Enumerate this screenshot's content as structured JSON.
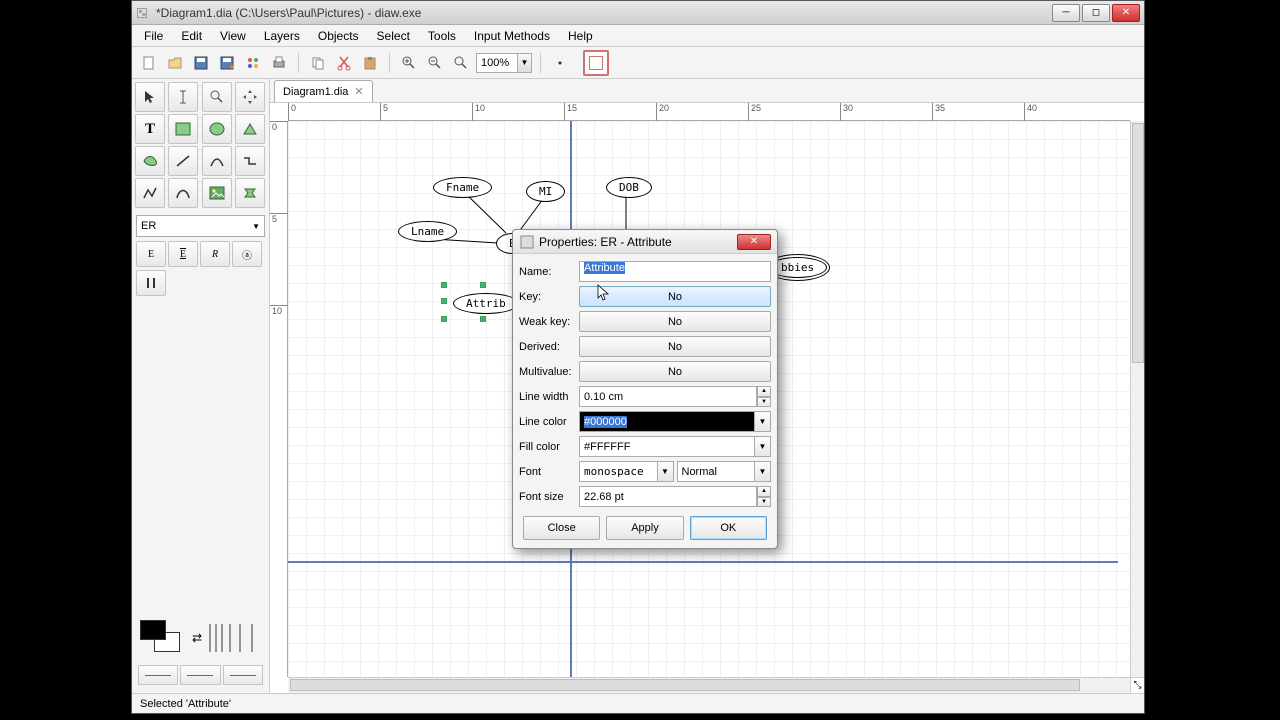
{
  "window": {
    "title": "*Diagram1.dia (C:\\Users\\Paul\\Pictures) - diaw.exe"
  },
  "menu": [
    "File",
    "Edit",
    "View",
    "Layers",
    "Objects",
    "Select",
    "Tools",
    "Input Methods",
    "Help"
  ],
  "toolbar": {
    "zoom": "100%"
  },
  "sheet": "ER",
  "tab": {
    "label": "Diagram1.dia"
  },
  "ruler_h": [
    "0",
    "5",
    "10",
    "15",
    "20",
    "25",
    "30",
    "35",
    "40"
  ],
  "ruler_v": [
    "0",
    "5",
    "10"
  ],
  "canvas": {
    "attrs": {
      "fname": "Fname",
      "mi": "MI",
      "dob": "DOB",
      "lname": "Lname",
      "e": "E",
      "hobbies": "bbies",
      "attribute": "Attrib"
    }
  },
  "dialog": {
    "title": "Properties: ER - Attribute",
    "labels": {
      "name": "Name:",
      "key": "Key:",
      "weakkey": "Weak key:",
      "derived": "Derived:",
      "multivalue": "Multivalue:",
      "linewidth": "Line width",
      "linecolor": "Line color",
      "fillcolor": "Fill color",
      "font": "Font",
      "fontsize": "Font size"
    },
    "values": {
      "name": "Attribute",
      "key": "No",
      "weakkey": "No",
      "derived": "No",
      "multivalue": "No",
      "linewidth": "0.10 cm",
      "linecolor": "#000000",
      "fillcolor": "#FFFFFF",
      "fontfamily": "monospace",
      "fontstyle": "Normal",
      "fontsize": "22.68 pt"
    },
    "buttons": {
      "close": "Close",
      "apply": "Apply",
      "ok": "OK"
    }
  },
  "status": "Selected 'Attribute'"
}
